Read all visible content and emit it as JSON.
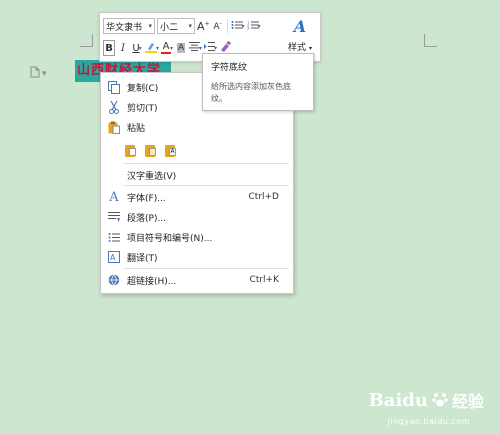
{
  "document": {
    "selected_text": "山西财经大学"
  },
  "toolbar": {
    "font_name": "华文隶书",
    "font_size": "小二",
    "grow_font": "A",
    "shrink_font": "A",
    "bold": "B",
    "italic": "I",
    "underline": "U",
    "font_color_glyph": "A",
    "char_shading_glyph": "A",
    "style_label": "样式",
    "style_glyph": "A"
  },
  "tooltip": {
    "title": "字符底纹",
    "description": "给所选内容添加灰色底纹。"
  },
  "context_menu": {
    "items": [
      {
        "label": "复制(C)",
        "shortcut": "",
        "icon": "copy-icon"
      },
      {
        "label": "剪切(T)",
        "shortcut": "",
        "icon": "cut-icon"
      },
      {
        "label": "粘贴",
        "shortcut": "",
        "icon": "paste-icon"
      },
      {
        "label": "汉字重选(V)",
        "shortcut": "",
        "icon": ""
      },
      {
        "label": "字体(F)...",
        "shortcut": "Ctrl+D",
        "icon": "font-icon"
      },
      {
        "label": "段落(P)...",
        "shortcut": "",
        "icon": "paragraph-icon"
      },
      {
        "label": "项目符号和编号(N)...",
        "shortcut": "",
        "icon": "bullets-icon"
      },
      {
        "label": "翻译(T)",
        "shortcut": "",
        "icon": "translate-icon"
      },
      {
        "label": "超链接(H)...",
        "shortcut": "Ctrl+K",
        "icon": "hyperlink-icon"
      }
    ],
    "paste_options": [
      "paste-keep-format-icon",
      "paste-merge-format-icon",
      "paste-text-only-icon"
    ]
  },
  "watermark": {
    "brand": "Baidu",
    "label": "经验",
    "url": "jingyan.baidu.com"
  },
  "colors": {
    "background": "#cde6cf",
    "selection_highlight": "#2aa8a0",
    "selected_text_color": "#c3163a",
    "accent_blue": "#2a72c8",
    "font_color_red": "#e02020",
    "highlight_yellow": "#f2d800"
  }
}
